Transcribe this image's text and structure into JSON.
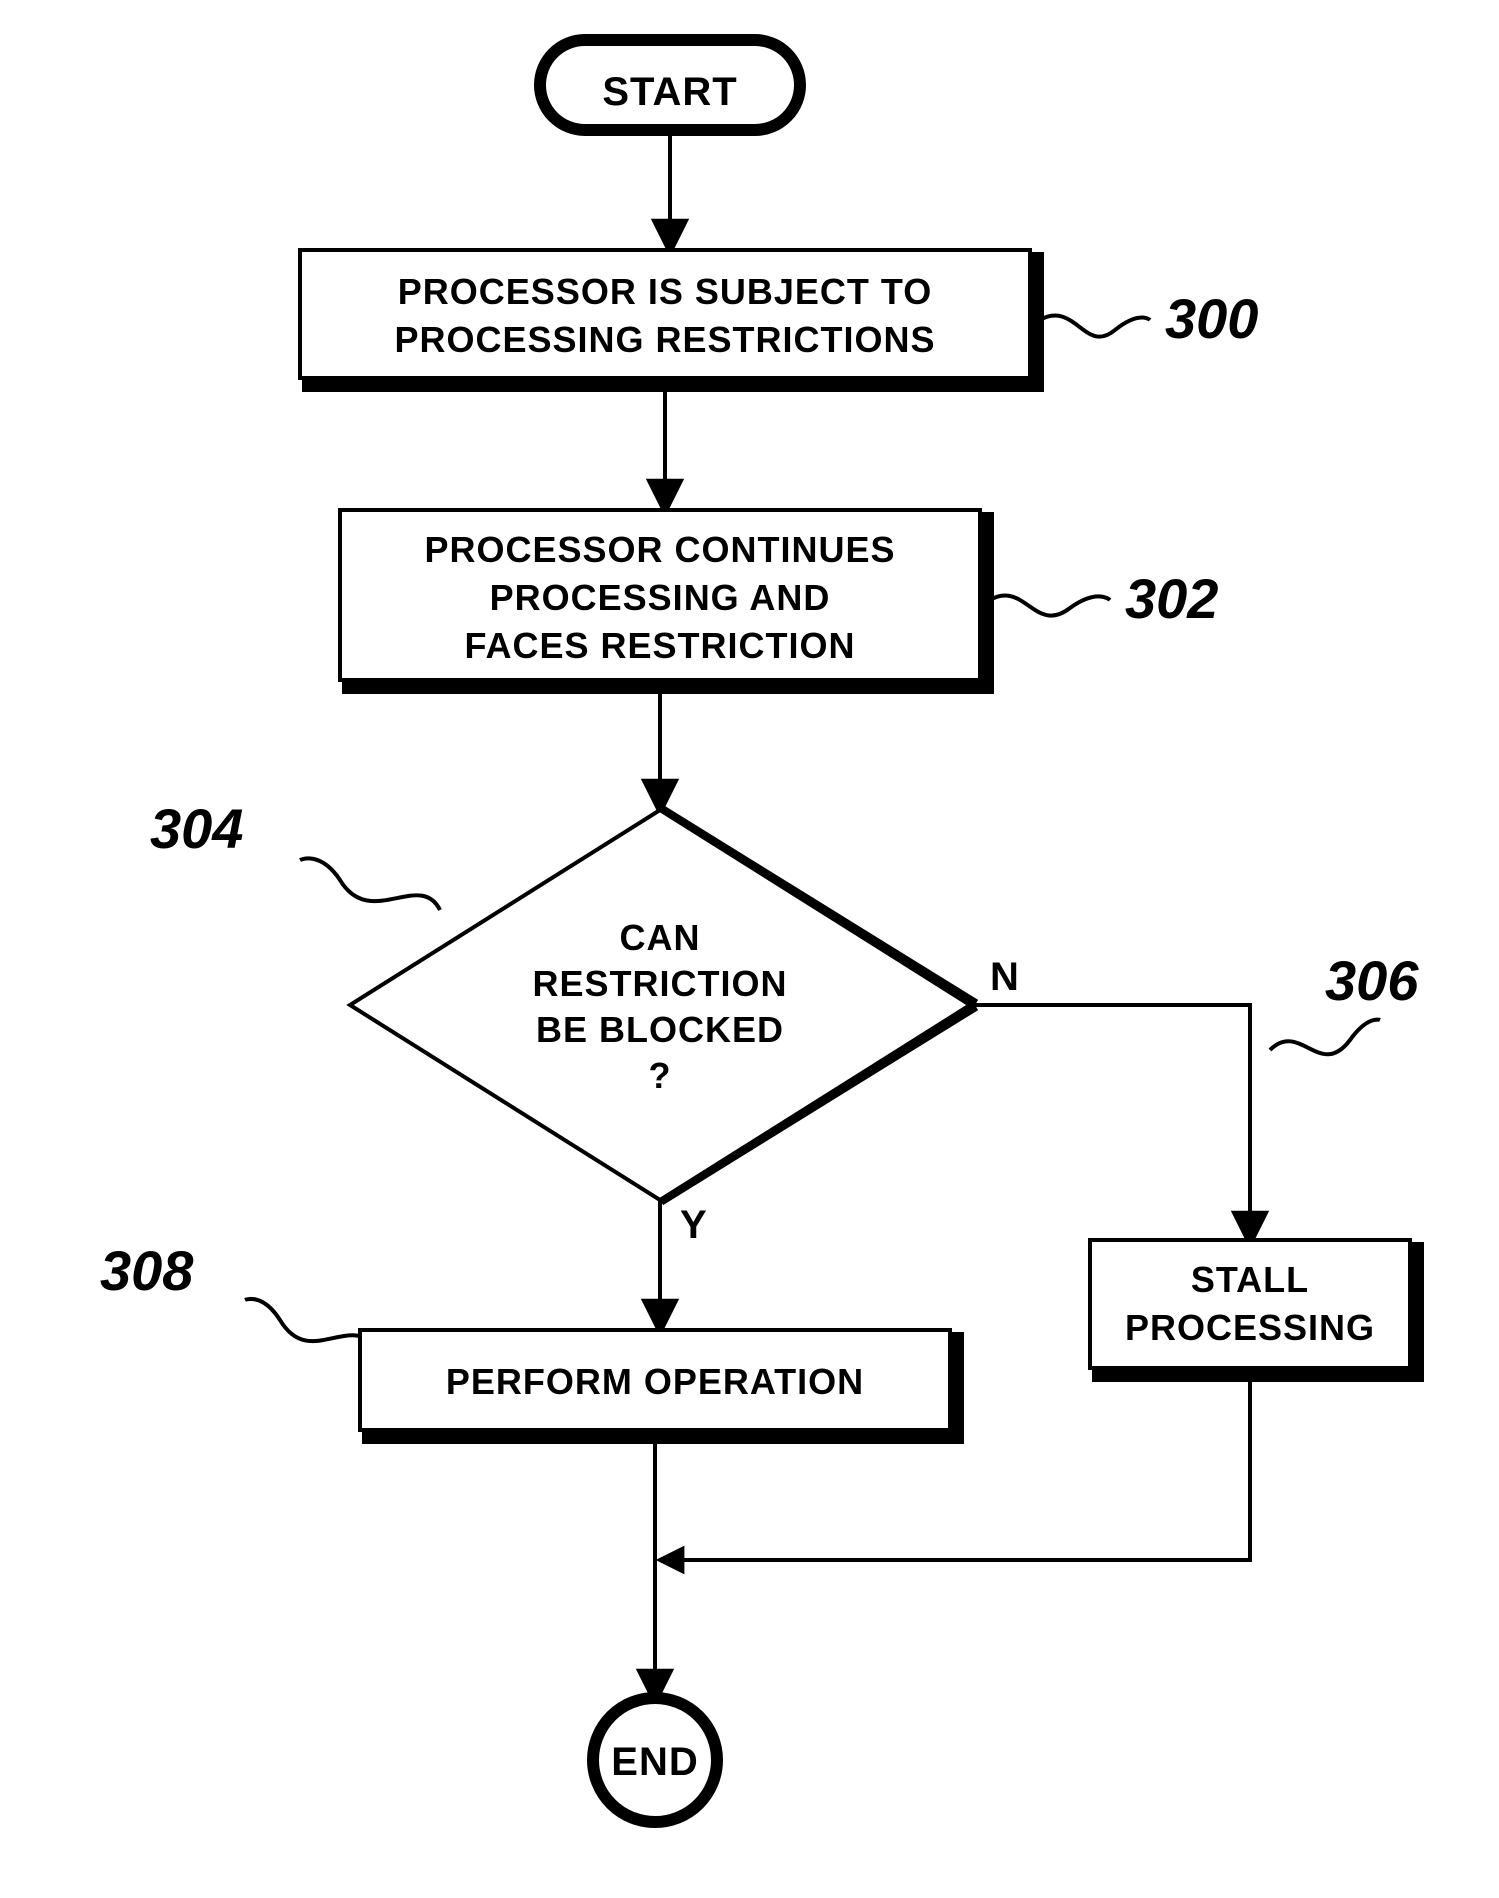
{
  "terminals": {
    "start": "START",
    "end": "END"
  },
  "steps": {
    "s300": {
      "line1": "PROCESSOR IS SUBJECT TO",
      "line2": "PROCESSING RESTRICTIONS"
    },
    "s302": {
      "line1": "PROCESSOR CONTINUES",
      "line2": "PROCESSING AND",
      "line3": "FACES RESTRICTION"
    },
    "s304": {
      "line1": "CAN",
      "line2": "RESTRICTION",
      "line3": "BE BLOCKED",
      "line4": "?"
    },
    "s306": {
      "line1": "STALL",
      "line2": "PROCESSING"
    },
    "s308": {
      "line1": "PERFORM OPERATION"
    }
  },
  "branches": {
    "yes": "Y",
    "no": "N"
  },
  "labels": {
    "l300": "300",
    "l302": "302",
    "l304": "304",
    "l306": "306",
    "l308": "308"
  }
}
